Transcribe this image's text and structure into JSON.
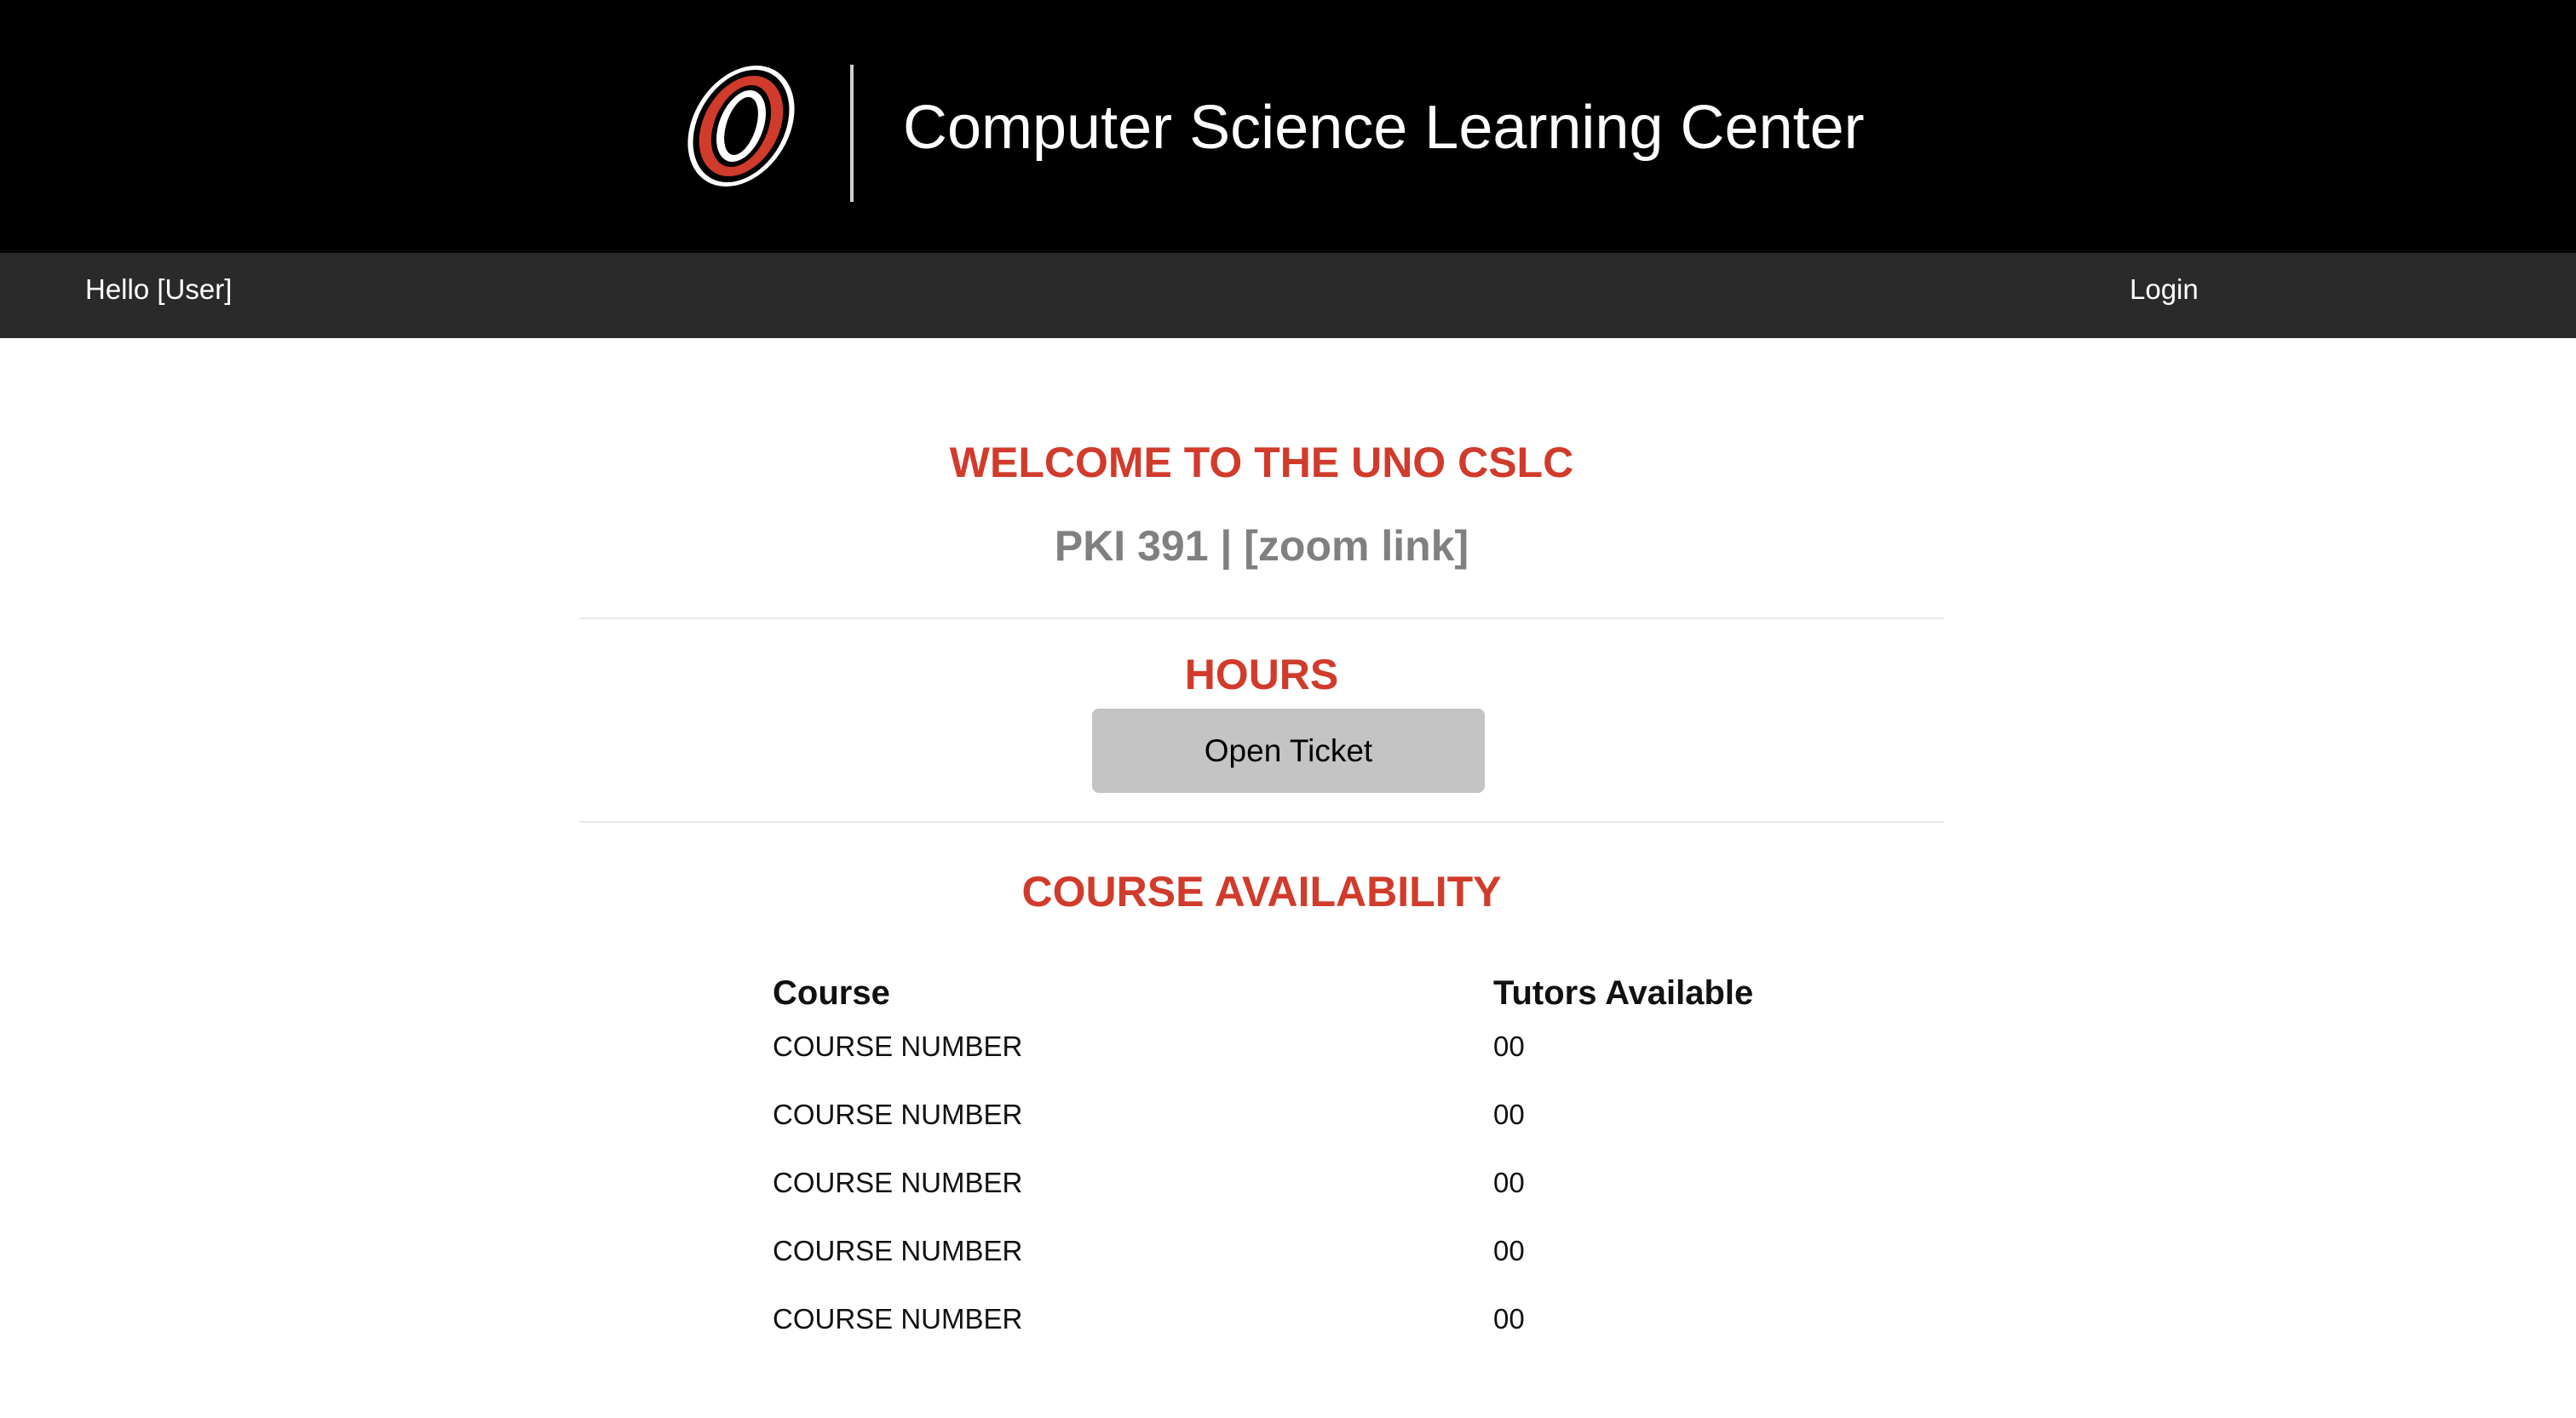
{
  "header": {
    "logo_icon": "uno-o-logo-icon",
    "title": "Computer Science Learning Center",
    "accent_color": "#d13b2c"
  },
  "navbar": {
    "greeting": "Hello [User]",
    "login_label": "Login"
  },
  "main": {
    "welcome_heading": "WELCOME TO THE UNO CSLC",
    "location": "PKI 391 | [zoom link]",
    "hours_heading": "HOURS",
    "open_ticket_label": "Open Ticket",
    "availability_heading": "COURSE AVAILABILITY"
  },
  "availability_table": {
    "headers": [
      "Course",
      "Tutors Available"
    ],
    "rows": [
      {
        "course": "COURSE NUMBER",
        "tutors": "00"
      },
      {
        "course": "COURSE NUMBER",
        "tutors": "00"
      },
      {
        "course": "COURSE NUMBER",
        "tutors": "00"
      },
      {
        "course": "COURSE NUMBER",
        "tutors": "00"
      },
      {
        "course": "COURSE NUMBER",
        "tutors": "00"
      }
    ]
  }
}
